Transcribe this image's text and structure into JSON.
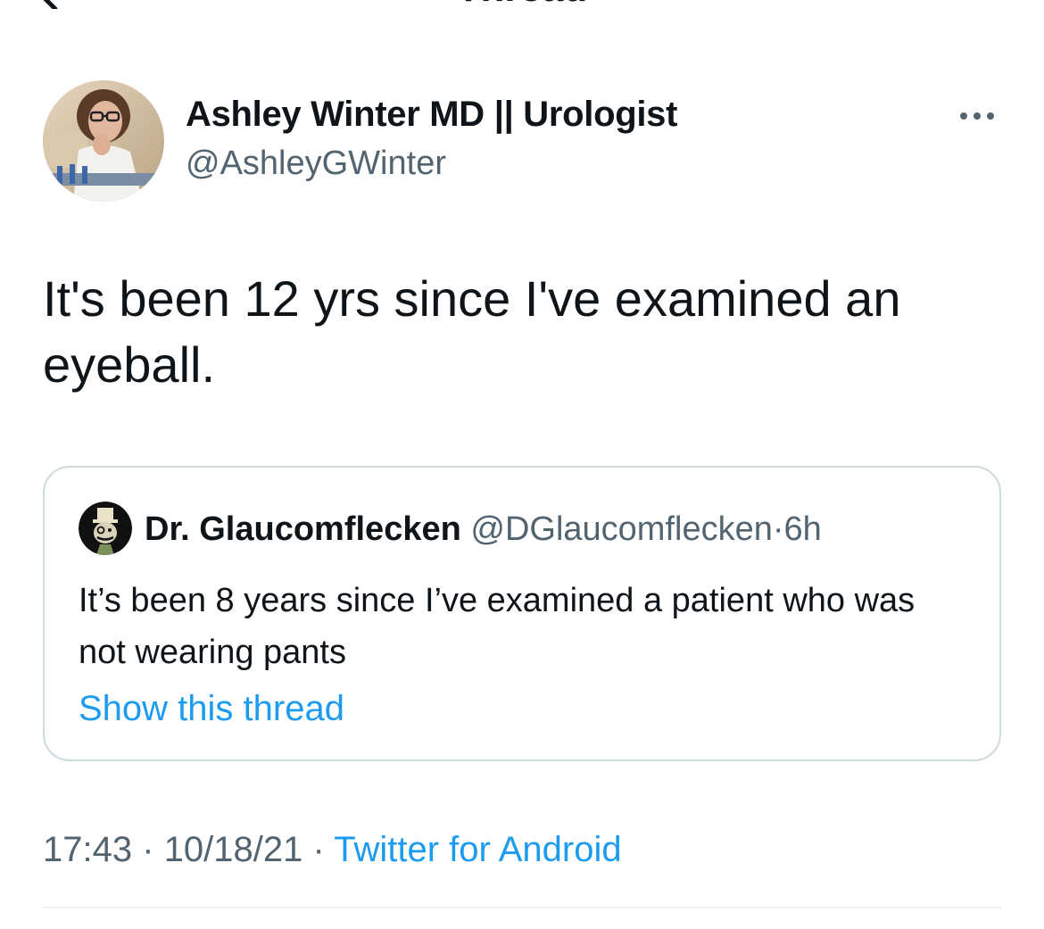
{
  "header": {
    "title": "Thread",
    "back_icon": "arrow-left-icon"
  },
  "tweet": {
    "author_name": "Ashley Winter MD || Urologist",
    "author_handle": "@AshleyGWinter",
    "more_icon": "more-horizontal-icon",
    "text": "It's been 12 yrs since I've examined an eyeball.",
    "quoted": {
      "author_name": "Dr. Glaucomflecken",
      "author_handle": "@DGlaucomflecken",
      "separator": "·",
      "time": "6h",
      "text": "It’s been 8 years since I’ve examined a patient who was not wearing pants",
      "show_thread": "Show this thread"
    },
    "meta": {
      "time": "17:43",
      "separator": "·",
      "date": "10/18/21",
      "source": "Twitter for Android"
    }
  },
  "colors": {
    "text": "#0f1419",
    "secondary": "#536471",
    "link": "#1d9bf0",
    "border": "#cfd9de"
  }
}
